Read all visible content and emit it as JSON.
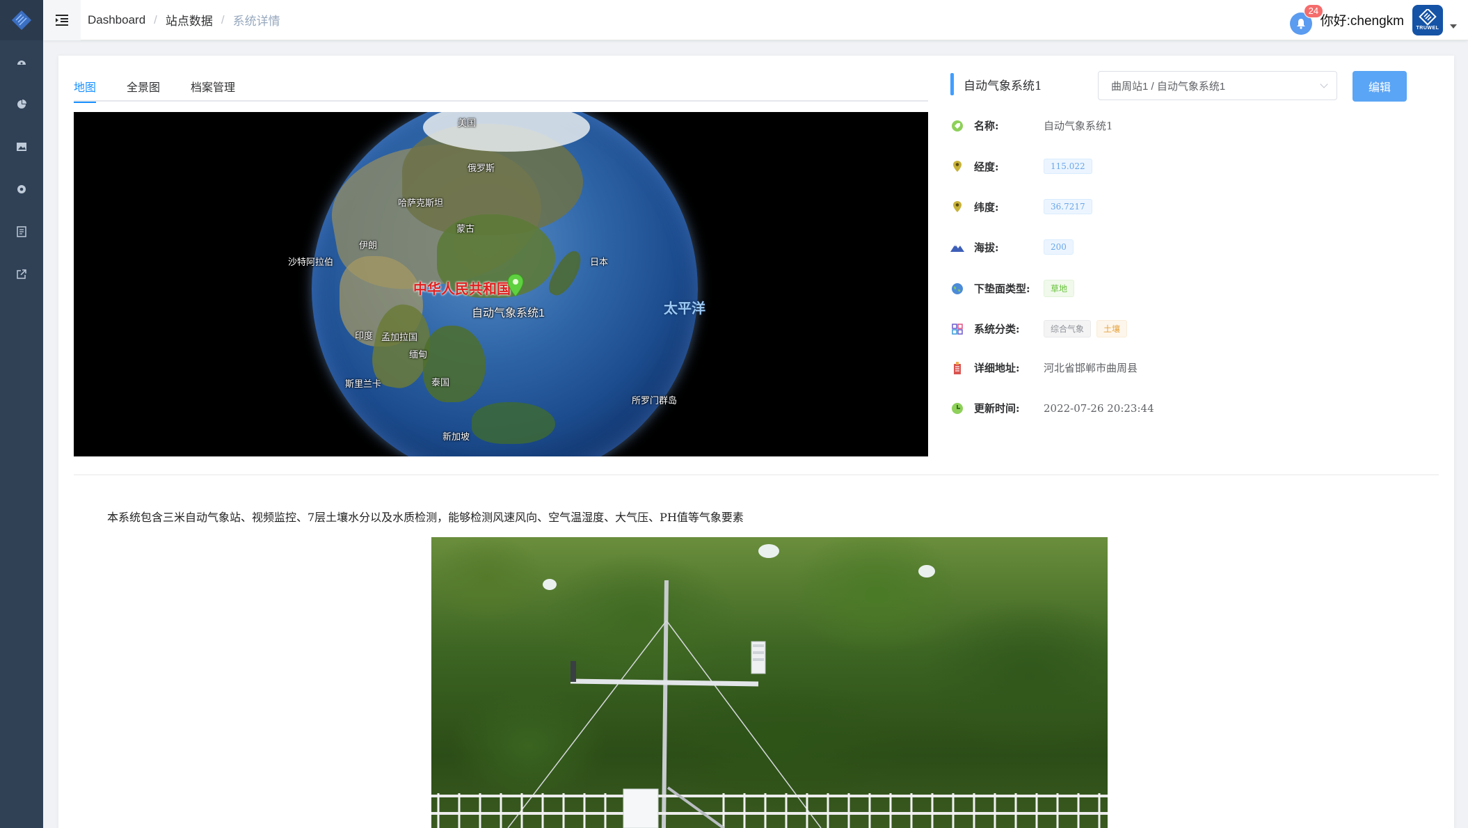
{
  "header": {
    "breadcrumb": [
      "Dashboard",
      "站点数据",
      "系统详情"
    ],
    "notification_count": "24",
    "greeting": "你好:chengkm",
    "avatar_text": "TRUWEL"
  },
  "sidebar": {
    "items": [
      {
        "icon": "dashboard-icon"
      },
      {
        "icon": "pie-chart-icon"
      },
      {
        "icon": "image-icon"
      },
      {
        "icon": "gear-icon"
      },
      {
        "icon": "document-icon"
      },
      {
        "icon": "external-link-icon"
      }
    ]
  },
  "tabs": [
    {
      "label": "地图",
      "active": true
    },
    {
      "label": "全景图",
      "active": false
    },
    {
      "label": "档案管理",
      "active": false
    }
  ],
  "map": {
    "labels": {
      "usa": "美国",
      "russia": "俄罗斯",
      "kazakhstan": "哈萨克斯坦",
      "mongolia": "蒙古",
      "iran": "伊朗",
      "saudi": "沙特阿拉伯",
      "china": "中华人民共和国",
      "station": "自动气象系统1",
      "japan": "日本",
      "pacific": "太平洋",
      "india": "印度",
      "bangladesh": "孟加拉国",
      "myanmar": "缅甸",
      "srilanka": "斯里兰卡",
      "thailand": "泰国",
      "solomon": "所罗门群岛",
      "singapore": "新加坡"
    }
  },
  "panel": {
    "title": "自动气象系统1",
    "select_value": "曲周站1 / 自动气象系统1",
    "edit_label": "编辑",
    "fields": {
      "name_label": "名称:",
      "name_value": "自动气象系统1",
      "lng_label": "经度:",
      "lng_value": "115.022",
      "lat_label": "纬度:",
      "lat_value": "36.7217",
      "alt_label": "海拔:",
      "alt_value": "200",
      "surface_label": "下垫面类型:",
      "surface_value": "草地",
      "category_label": "系统分类:",
      "category_values": [
        "综合气象",
        "土壤"
      ],
      "address_label": "详细地址:",
      "address_value": "河北省邯郸市曲周县",
      "updated_label": "更新时间:",
      "updated_value": "2022-07-26 20:23:44"
    }
  },
  "description": "本系统包含三米自动气象站、视频监控、7层土壤水分以及水质检测，能够检测风速风向、空气温湿度、大气压、PH值等气象要素",
  "colors": {
    "sidebar": "#304156",
    "accent": "#1890ff",
    "button": "#5aa5f5"
  }
}
